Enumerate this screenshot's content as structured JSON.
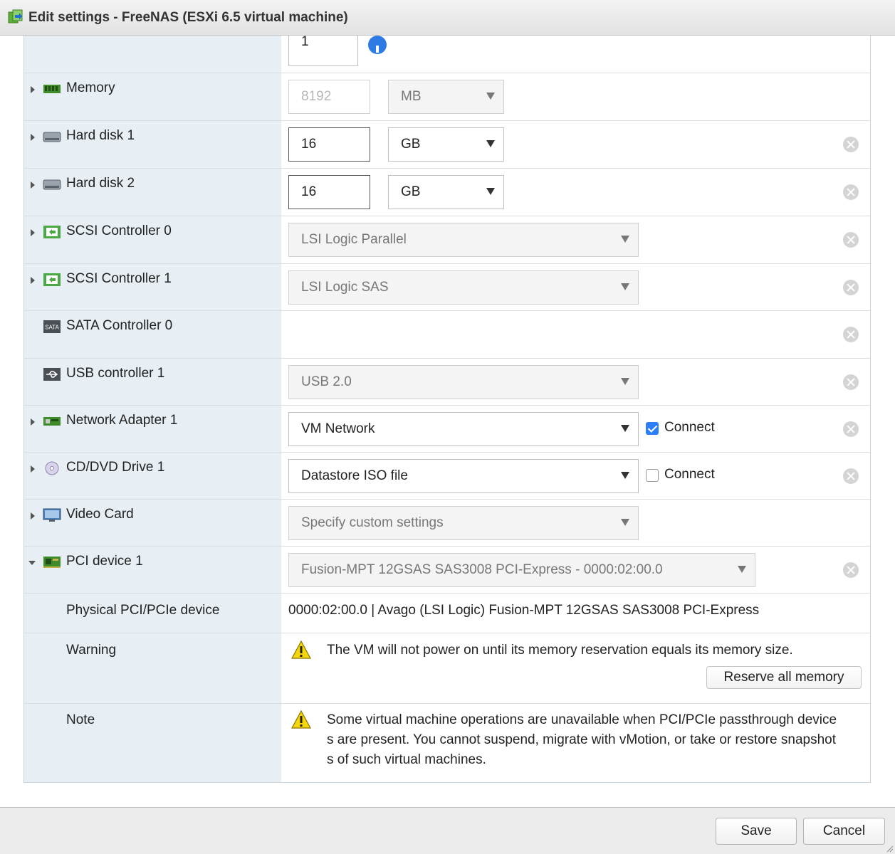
{
  "window": {
    "title": "Edit settings - FreeNAS (ESXi 6.5 virtual machine)"
  },
  "partial_row": {
    "value": "1"
  },
  "memory": {
    "label": "Memory",
    "value": "8192",
    "unit": "MB"
  },
  "hard_disk_1": {
    "label": "Hard disk 1",
    "value": "16",
    "unit": "GB"
  },
  "hard_disk_2": {
    "label": "Hard disk 2",
    "value": "16",
    "unit": "GB"
  },
  "scsi_0": {
    "label": "SCSI Controller 0",
    "value": "LSI Logic Parallel"
  },
  "scsi_1": {
    "label": "SCSI Controller 1",
    "value": "LSI Logic SAS"
  },
  "sata_0": {
    "label": "SATA Controller 0",
    "icon_text": "SATA"
  },
  "usb_1": {
    "label": "USB controller 1",
    "value": "USB 2.0"
  },
  "network_1": {
    "label": "Network Adapter 1",
    "value": "VM Network",
    "connect_label": "Connect",
    "connected": true
  },
  "cddvd_1": {
    "label": "CD/DVD Drive 1",
    "value": "Datastore ISO file",
    "connect_label": "Connect",
    "connected": false
  },
  "video_card": {
    "label": "Video Card",
    "value": "Specify custom settings"
  },
  "pci_1": {
    "label": "PCI device 1",
    "value": "Fusion-MPT 12GSAS SAS3008 PCI-Express - 0000:02:00.0"
  },
  "physical_pci": {
    "label": "Physical PCI/PCIe device",
    "value": "0000:02:00.0 | Avago (LSI Logic) Fusion-MPT 12GSAS SAS3008 PCI-Express"
  },
  "warning": {
    "label": "Warning",
    "text": "The VM will not power on until its memory reservation equals its memory size.",
    "button": "Reserve all memory"
  },
  "note": {
    "label": "Note",
    "line1": "Some virtual machine operations are unavailable when PCI/PCIe passthrough device",
    "line2": "s are present. You cannot suspend, migrate with vMotion, or take or restore snapshot",
    "line3": "s of such virtual machines."
  },
  "footer": {
    "save": "Save",
    "cancel": "Cancel"
  },
  "colors": {
    "accent": "#2d7ff9",
    "left_column_bg": "#e7eff5",
    "warning_yellow": "#f5d60a"
  }
}
